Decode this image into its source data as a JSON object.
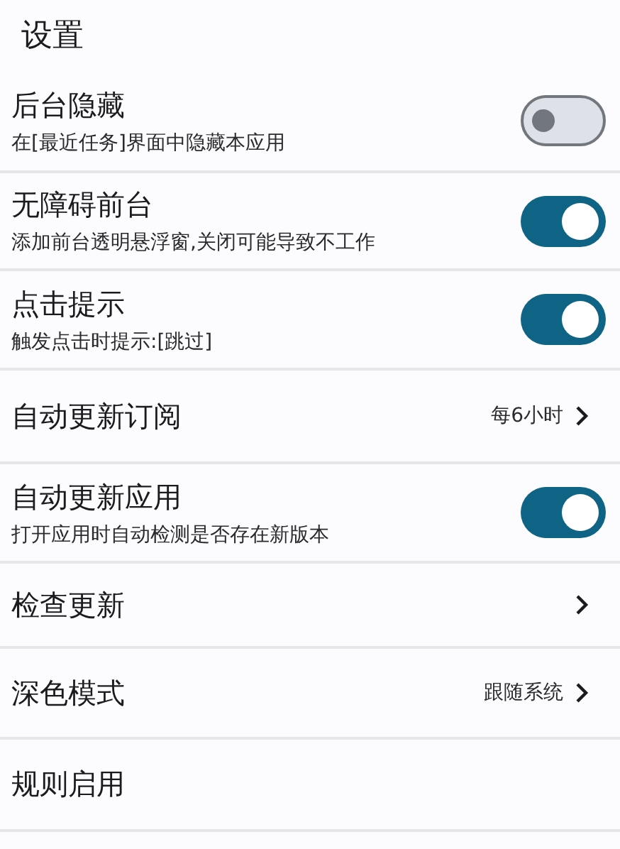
{
  "title": "设置",
  "settings": [
    {
      "kind": "switch",
      "label": "后台隐藏",
      "description": "在[最近任务]界面中隐藏本应用",
      "on": false
    },
    {
      "kind": "switch",
      "label": "无障碍前台",
      "description": "添加前台透明悬浮窗,关闭可能导致不工作",
      "on": true
    },
    {
      "kind": "switch",
      "label": "点击提示",
      "description": "触发点击时提示:[跳过]",
      "on": true
    },
    {
      "kind": "link",
      "label": "自动更新订阅",
      "value": "每6小时"
    },
    {
      "kind": "switch",
      "label": "自动更新应用",
      "description": "打开应用时自动检测是否存在新版本",
      "on": true
    },
    {
      "kind": "link",
      "label": "检查更新"
    },
    {
      "kind": "link",
      "label": "深色模式",
      "value": "跟随系统"
    },
    {
      "kind": "plain",
      "label": "规则启用"
    }
  ]
}
